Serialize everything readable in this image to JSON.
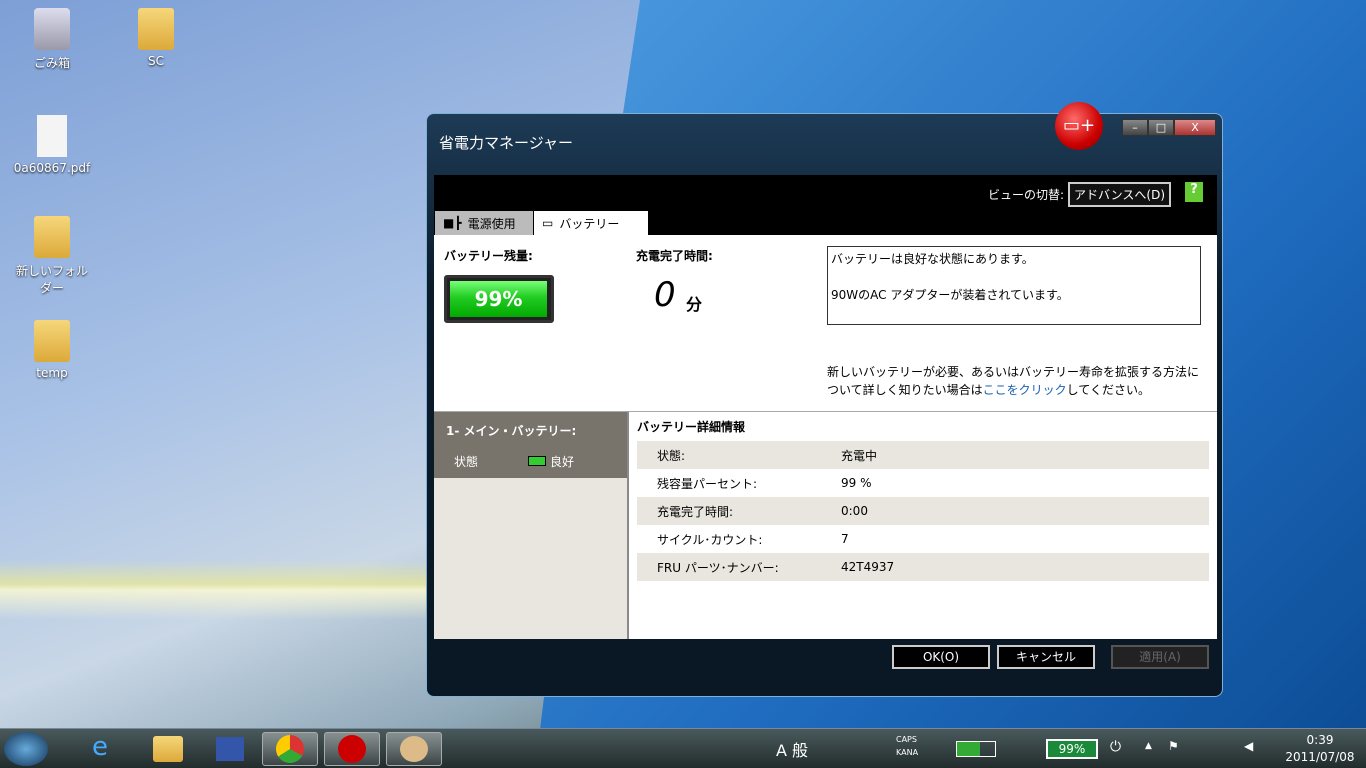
{
  "desktop": {
    "icons": [
      {
        "label": "ごみ箱"
      },
      {
        "label": "SC"
      },
      {
        "label": "0a60867.pdf"
      },
      {
        "label": "新しいフォルダー"
      },
      {
        "label": "temp"
      }
    ]
  },
  "window": {
    "title": "省電力マネージャー",
    "view_switch_label": "ビューの切替:",
    "advanced_button": "アドバンスへ(D)",
    "tabs": [
      {
        "label": "電源使用"
      },
      {
        "label": "バッテリー"
      }
    ],
    "battery_remaining_label": "バッテリー残量:",
    "battery_percent": "99%",
    "battery_level": 0.99,
    "charge_time_label": "充電完了時間:",
    "charge_time_value": "0",
    "charge_time_unit": "分",
    "status_lines": [
      "バッテリーは良好な状態にあります。",
      "90WのAC アダプターが装着されています。"
    ],
    "info_text_before": "新しいバッテリーが必要、あるいはバッテリー寿命を拡張する方法について詳しく知りたい場合は",
    "info_link": "ここをクリック",
    "info_text_after": "してください。",
    "battery_list": {
      "header": "1- メイン・バッテリー:",
      "status_label": "状態",
      "status_value": "良好"
    },
    "details": {
      "title": "バッテリー詳細情報",
      "rows": [
        {
          "k": "状態:",
          "v": "充電中"
        },
        {
          "k": "残容量パーセント:",
          "v": "99 %"
        },
        {
          "k": "充電完了時間:",
          "v": "0:00"
        },
        {
          "k": "サイクル･カウント:",
          "v": "7"
        },
        {
          "k": "FRU パーツ･ナンバー:",
          "v": "42T4937"
        }
      ]
    },
    "buttons": {
      "ok": "OK(O)",
      "cancel": "キャンセル",
      "apply": "適用(A)"
    }
  },
  "taskbar": {
    "ime": "A 般",
    "caps": "CAPS",
    "kana": "KANA",
    "battery": "99%",
    "time": "0:39",
    "date": "2011/07/08"
  }
}
